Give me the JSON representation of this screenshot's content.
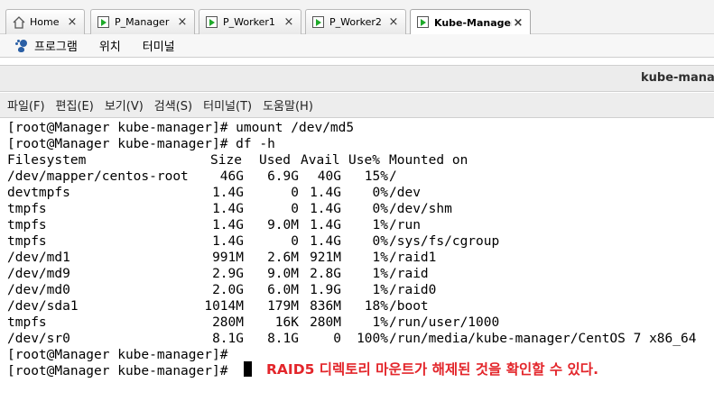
{
  "tabs": [
    {
      "label": "Home",
      "icon": "home-icon",
      "active": false
    },
    {
      "label": "P_Manager",
      "icon": "vm-icon",
      "active": false
    },
    {
      "label": "P_Worker1",
      "icon": "vm-icon",
      "active": false
    },
    {
      "label": "P_Worker2",
      "icon": "vm-icon",
      "active": false
    },
    {
      "label": "Kube-Manager",
      "icon": "vm-icon",
      "active": true
    }
  ],
  "close_glyph": "×",
  "appmenu": {
    "items": [
      "프로그램",
      "위치",
      "터미널"
    ]
  },
  "window_title": "kube-manag",
  "terminal_menu": [
    "파일(F)",
    "편집(E)",
    "보기(V)",
    "검색(S)",
    "터미널(T)",
    "도움말(H)"
  ],
  "terminal": {
    "prompt": "[root@Manager kube-manager]#",
    "lines": [
      "[root@Manager kube-manager]# umount /dev/md5",
      "[root@Manager kube-manager]# df -h"
    ],
    "df_header": [
      "Filesystem",
      "Size",
      "Used",
      "Avail",
      "Use%",
      "Mounted on"
    ],
    "df_rows": [
      [
        "/dev/mapper/centos-root",
        "46G",
        "6.9G",
        "40G",
        "15%",
        "/"
      ],
      [
        "devtmpfs",
        "1.4G",
        "0",
        "1.4G",
        "0%",
        "/dev"
      ],
      [
        "tmpfs",
        "1.4G",
        "0",
        "1.4G",
        "0%",
        "/dev/shm"
      ],
      [
        "tmpfs",
        "1.4G",
        "9.0M",
        "1.4G",
        "1%",
        "/run"
      ],
      [
        "tmpfs",
        "1.4G",
        "0",
        "1.4G",
        "0%",
        "/sys/fs/cgroup"
      ],
      [
        "/dev/md1",
        "991M",
        "2.6M",
        "921M",
        "1%",
        "/raid1"
      ],
      [
        "/dev/md9",
        "2.9G",
        "9.0M",
        "2.8G",
        "1%",
        "/raid"
      ],
      [
        "/dev/md0",
        "2.0G",
        "6.0M",
        "1.9G",
        "1%",
        "/raid0"
      ],
      [
        "/dev/sda1",
        "1014M",
        "179M",
        "836M",
        "18%",
        "/boot"
      ],
      [
        "tmpfs",
        "280M",
        "16K",
        "280M",
        "1%",
        "/run/user/1000"
      ],
      [
        "/dev/sr0",
        "8.1G",
        "8.1G",
        "0",
        "100%",
        "/run/media/kube-manager/CentOS 7 x86_64"
      ]
    ],
    "trailing_prompts": [
      "[root@Manager kube-manager]#",
      "[root@Manager kube-manager]#"
    ]
  },
  "annotation": "RAID5 디렉토리 마운트가 해제된 것을 확인할 수 있다.",
  "colors": {
    "annotation": "#e3262b",
    "vm_play": "#1faa2a"
  }
}
